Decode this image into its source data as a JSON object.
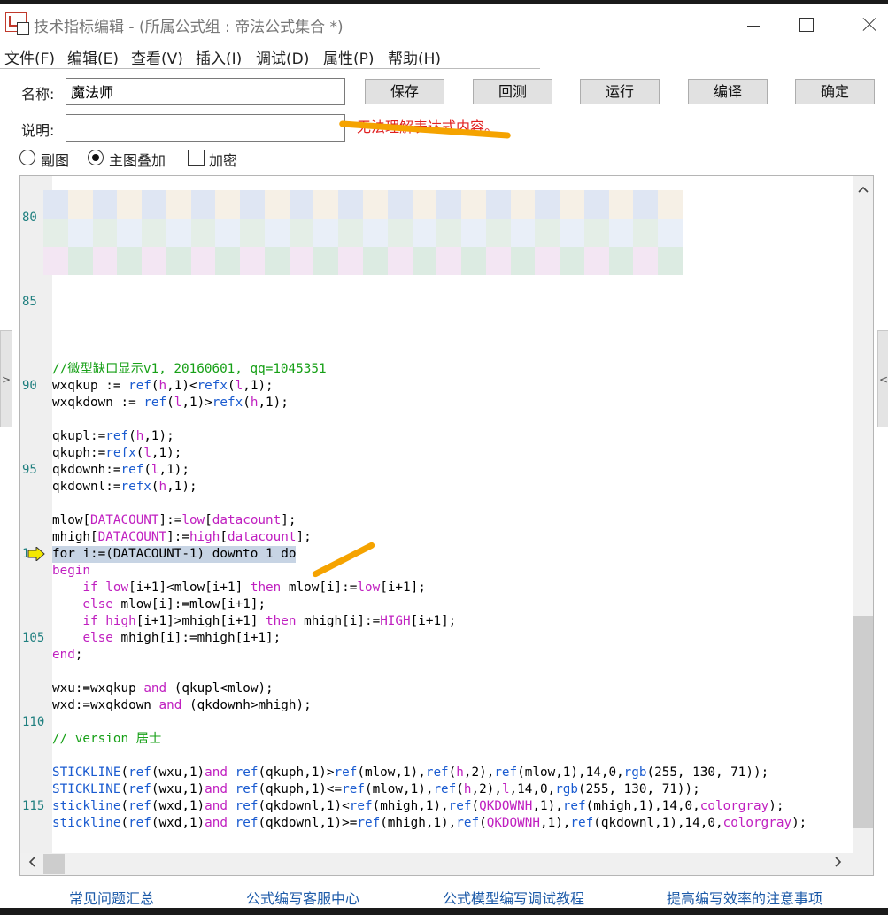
{
  "window": {
    "title": "技术指标编辑 - (所属公式组 : 帝法公式集合 *)"
  },
  "menu": [
    "文件(F)",
    "编辑(E)",
    "查看(V)",
    "插入(I)",
    "调试(D)",
    "属性(P)",
    "帮助(H)"
  ],
  "form": {
    "name_label": "名称:",
    "name_value": "魔法师",
    "desc_label": "说明:",
    "desc_value": "",
    "error_message": "无法理解表达式内容。",
    "buttons": [
      "保存",
      "回测",
      "运行",
      "编译",
      "确定"
    ],
    "radio_sub": "副图",
    "radio_main": "主图叠加",
    "radio_selected": "主图叠加",
    "checkbox_encrypt": "加密",
    "checkbox_checked": false
  },
  "editor": {
    "line_numbers": [
      "80",
      "85",
      "90",
      "95",
      "1",
      "105",
      "110",
      "115"
    ],
    "current_line_text": "for i:=(DATACOUNT-1) downto 1 do",
    "code": [
      "//微型缺口显示v1, 20160601, qq=1045351",
      "wxqkup := ref(h,1)<refx(l,1);",
      "wxqkdown := ref(l,1)>refx(h,1);",
      "",
      "qkupl:=ref(h,1);",
      "qkuph:=refx(l,1);",
      "qkdownh:=ref(l,1);",
      "qkdownl:=refx(h,1);",
      "",
      "mlow[DATACOUNT]:=low[datacount];",
      "mhigh[DATACOUNT]:=high[datacount];",
      "for i:=(DATACOUNT-1) downto 1 do",
      "begin",
      "    if low[i+1]<mlow[i+1] then mlow[i]:=low[i+1];",
      "    else mlow[i]:=mlow[i+1];",
      "    if high[i+1]>mhigh[i+1] then mhigh[i]:=HIGH[i+1];",
      "    else mhigh[i]:=mhigh[i+1];",
      "end;",
      "",
      "wxu:=wxqkup and (qkupl<mlow);",
      "wxd:=wxqkdown and (qkdownh>mhigh);",
      "",
      "// version 居士",
      "",
      "STICKLINE(ref(wxu,1)and ref(qkuph,1)>ref(mlow,1),ref(h,2),ref(mlow,1),14,0,rgb(255, 130, 71));",
      "STICKLINE(ref(wxu,1)and ref(qkuph,1)<=ref(mlow,1),ref(h,2),l,14,0,rgb(255, 130, 71));",
      "stickline(ref(wxd,1)and ref(qkdownl,1)<ref(mhigh,1),ref(QKDOWNH,1),ref(mhigh,1),14,0,colorgray);",
      "stickline(ref(wxd,1)and ref(qkdownl,1)>=ref(mhigh,1),ref(QKDOWNH,1),ref(qkdownl,1),14,0,colorgray);"
    ]
  },
  "scroll": {
    "up_arrow": "^",
    "down_arrow": "v",
    "left_arrow": "<",
    "right_arrow": ">"
  },
  "side_tabs": {
    "left": ">",
    "right": "<"
  },
  "footer_links": [
    "常见问题汇总",
    "公式编写客服中心",
    "公式模型编写调试教程",
    "提高编写效率的注意事项"
  ],
  "colors": {
    "accent_error": "#e02020",
    "highlight_stroke": "#f5a300",
    "link": "#1c5aa8",
    "current_line": "#c7d4e4"
  }
}
